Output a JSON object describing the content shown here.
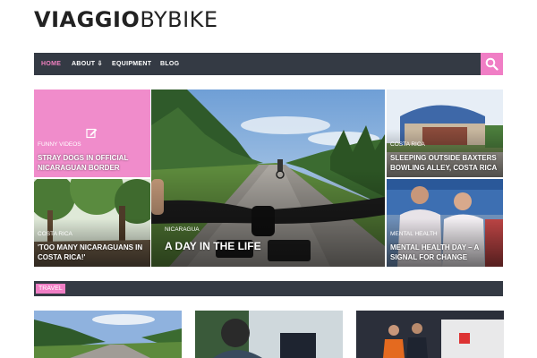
{
  "logo": {
    "bold": "VIAGGIO",
    "light": "BYBIKE"
  },
  "nav": {
    "items": [
      {
        "label": "HOME",
        "active": true
      },
      {
        "label": "ABOUT ⇩",
        "active": false
      },
      {
        "label": "EQUIPMENT",
        "active": false
      },
      {
        "label": "BLOG",
        "active": false
      }
    ],
    "search_icon": "search-icon"
  },
  "featured": [
    {
      "category": "FUNNY VIDEOS",
      "title": "STRAY DOGS IN OFFICIAL NICARAGUAN BORDER",
      "icon": "edit-icon"
    },
    {
      "category": "NICARAGUA",
      "title": "A DAY IN THE LIFE"
    },
    {
      "category": "COSTA RICA",
      "title": "SLEEPING OUTSIDE BAXTERS BOWLING ALLEY, COSTA RICA"
    },
    {
      "category": "COSTA RICA",
      "title": "'TOO MANY NICARAGUANS IN COSTA RICA!'"
    },
    {
      "category": "MENTAL HEALTH",
      "title": "MENTAL HEALTH DAY – A SIGNAL FOR CHANGE"
    }
  ],
  "section": {
    "label": "TRAVEL"
  },
  "colors": {
    "accent": "#f07ec5",
    "nav_bg": "#343a44",
    "active_nav": "#ef7fbf"
  }
}
